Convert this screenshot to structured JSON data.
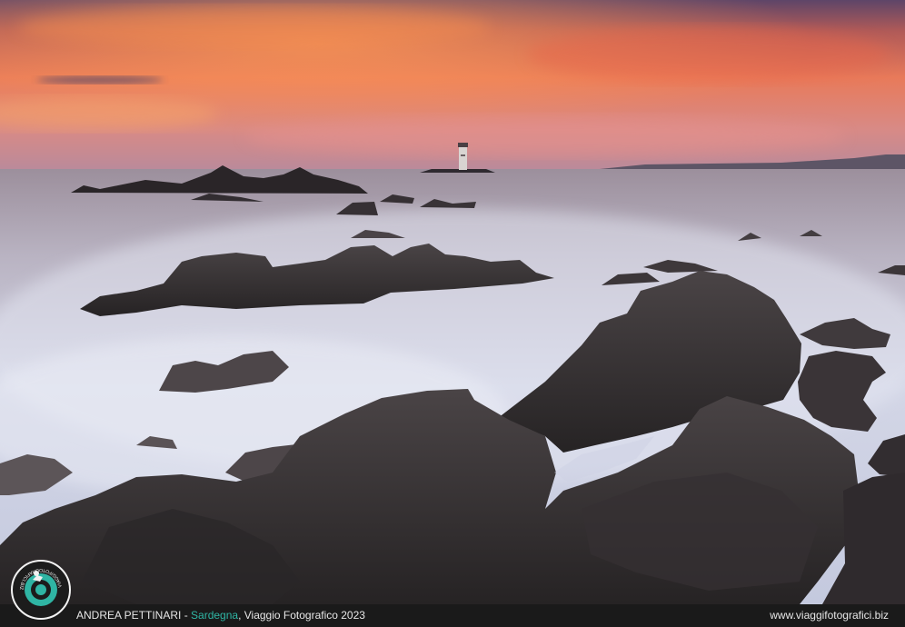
{
  "photo": {
    "subject": "long-exposure seascape with lighthouse at sunset",
    "colors": {
      "sky_top": "#6d4a6e",
      "sky_glow": "#f07a4e",
      "horizon": "#e6a08a",
      "sea_mist": "#c9cde0",
      "rock": "#2e2b2c"
    }
  },
  "caption": {
    "author": "ANDREA PETTINARI",
    "separator": " - ",
    "location": "Sardegna",
    "trip": ", Viaggio Fotografico 2023",
    "website": "www.viaggifotografici.biz",
    "accent_color": "#2fb5a4"
  },
  "logo": {
    "icon": "photographer-camera-icon",
    "text": "VIAGGIFOTOGRAFICI.BIZ"
  }
}
